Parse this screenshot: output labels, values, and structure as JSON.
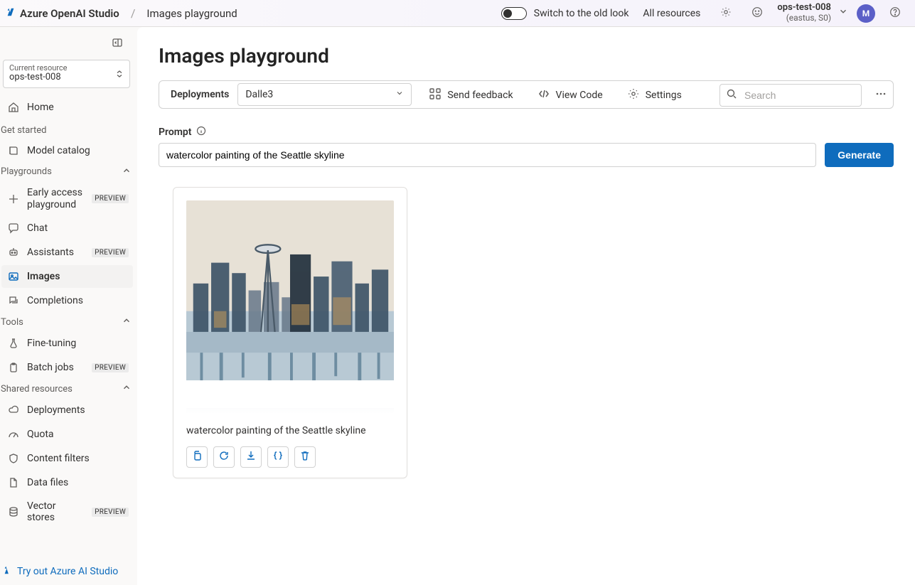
{
  "header": {
    "brand": "Azure OpenAI Studio",
    "breadcrumb": "Images playground",
    "switch_label": "Switch to the old look",
    "all_resources": "All resources",
    "account_name": "ops-test-008",
    "account_sub": "(eastus, S0)",
    "avatar_initial": "M"
  },
  "sidebar": {
    "resource_label": "Current resource",
    "resource_value": "ops-test-008",
    "home_label": "Home",
    "get_started_header": "Get started",
    "model_catalog_label": "Model catalog",
    "playgrounds_header": "Playgrounds",
    "early_access_label": "Early access playground",
    "chat_label": "Chat",
    "assistants_label": "Assistants",
    "images_label": "Images",
    "completions_label": "Completions",
    "tools_header": "Tools",
    "finetuning_label": "Fine-tuning",
    "batchjobs_label": "Batch jobs",
    "shared_header": "Shared resources",
    "deployments_label": "Deployments",
    "quota_label": "Quota",
    "contentfilters_label": "Content filters",
    "datafiles_label": "Data files",
    "vectorstores_label": "Vector stores",
    "preview_badge": "PREVIEW",
    "footer_label": "Try out Azure AI Studio"
  },
  "main": {
    "title": "Images playground",
    "toolbar": {
      "deployments_label": "Deployments",
      "selected_deployment": "Dalle3",
      "send_feedback": "Send feedback",
      "view_code": "View Code",
      "settings": "Settings",
      "search_placeholder": "Search"
    },
    "prompt": {
      "label": "Prompt",
      "value": "watercolor painting of the Seattle skyline",
      "generate_label": "Generate"
    },
    "gallery": {
      "items": [
        {
          "caption": "watercolor painting of the Seattle skyline"
        }
      ]
    }
  }
}
